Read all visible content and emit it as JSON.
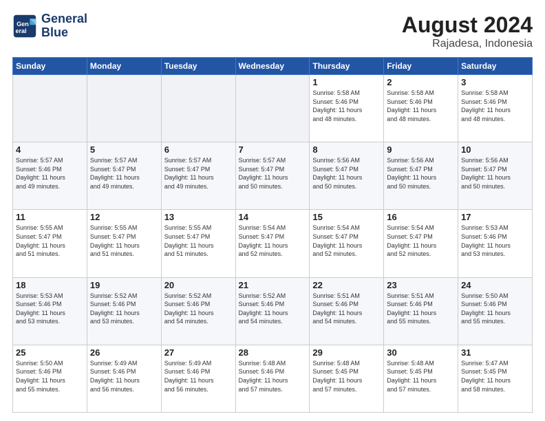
{
  "logo": {
    "line1": "General",
    "line2": "Blue"
  },
  "title": "August 2024",
  "subtitle": "Rajadesa, Indonesia",
  "weekdays": [
    "Sunday",
    "Monday",
    "Tuesday",
    "Wednesday",
    "Thursday",
    "Friday",
    "Saturday"
  ],
  "weeks": [
    [
      {
        "day": "",
        "info": ""
      },
      {
        "day": "",
        "info": ""
      },
      {
        "day": "",
        "info": ""
      },
      {
        "day": "",
        "info": ""
      },
      {
        "day": "1",
        "info": "Sunrise: 5:58 AM\nSunset: 5:46 PM\nDaylight: 11 hours\nand 48 minutes."
      },
      {
        "day": "2",
        "info": "Sunrise: 5:58 AM\nSunset: 5:46 PM\nDaylight: 11 hours\nand 48 minutes."
      },
      {
        "day": "3",
        "info": "Sunrise: 5:58 AM\nSunset: 5:46 PM\nDaylight: 11 hours\nand 48 minutes."
      }
    ],
    [
      {
        "day": "4",
        "info": "Sunrise: 5:57 AM\nSunset: 5:46 PM\nDaylight: 11 hours\nand 49 minutes."
      },
      {
        "day": "5",
        "info": "Sunrise: 5:57 AM\nSunset: 5:47 PM\nDaylight: 11 hours\nand 49 minutes."
      },
      {
        "day": "6",
        "info": "Sunrise: 5:57 AM\nSunset: 5:47 PM\nDaylight: 11 hours\nand 49 minutes."
      },
      {
        "day": "7",
        "info": "Sunrise: 5:57 AM\nSunset: 5:47 PM\nDaylight: 11 hours\nand 50 minutes."
      },
      {
        "day": "8",
        "info": "Sunrise: 5:56 AM\nSunset: 5:47 PM\nDaylight: 11 hours\nand 50 minutes."
      },
      {
        "day": "9",
        "info": "Sunrise: 5:56 AM\nSunset: 5:47 PM\nDaylight: 11 hours\nand 50 minutes."
      },
      {
        "day": "10",
        "info": "Sunrise: 5:56 AM\nSunset: 5:47 PM\nDaylight: 11 hours\nand 50 minutes."
      }
    ],
    [
      {
        "day": "11",
        "info": "Sunrise: 5:55 AM\nSunset: 5:47 PM\nDaylight: 11 hours\nand 51 minutes."
      },
      {
        "day": "12",
        "info": "Sunrise: 5:55 AM\nSunset: 5:47 PM\nDaylight: 11 hours\nand 51 minutes."
      },
      {
        "day": "13",
        "info": "Sunrise: 5:55 AM\nSunset: 5:47 PM\nDaylight: 11 hours\nand 51 minutes."
      },
      {
        "day": "14",
        "info": "Sunrise: 5:54 AM\nSunset: 5:47 PM\nDaylight: 11 hours\nand 52 minutes."
      },
      {
        "day": "15",
        "info": "Sunrise: 5:54 AM\nSunset: 5:47 PM\nDaylight: 11 hours\nand 52 minutes."
      },
      {
        "day": "16",
        "info": "Sunrise: 5:54 AM\nSunset: 5:47 PM\nDaylight: 11 hours\nand 52 minutes."
      },
      {
        "day": "17",
        "info": "Sunrise: 5:53 AM\nSunset: 5:46 PM\nDaylight: 11 hours\nand 53 minutes."
      }
    ],
    [
      {
        "day": "18",
        "info": "Sunrise: 5:53 AM\nSunset: 5:46 PM\nDaylight: 11 hours\nand 53 minutes."
      },
      {
        "day": "19",
        "info": "Sunrise: 5:52 AM\nSunset: 5:46 PM\nDaylight: 11 hours\nand 53 minutes."
      },
      {
        "day": "20",
        "info": "Sunrise: 5:52 AM\nSunset: 5:46 PM\nDaylight: 11 hours\nand 54 minutes."
      },
      {
        "day": "21",
        "info": "Sunrise: 5:52 AM\nSunset: 5:46 PM\nDaylight: 11 hours\nand 54 minutes."
      },
      {
        "day": "22",
        "info": "Sunrise: 5:51 AM\nSunset: 5:46 PM\nDaylight: 11 hours\nand 54 minutes."
      },
      {
        "day": "23",
        "info": "Sunrise: 5:51 AM\nSunset: 5:46 PM\nDaylight: 11 hours\nand 55 minutes."
      },
      {
        "day": "24",
        "info": "Sunrise: 5:50 AM\nSunset: 5:46 PM\nDaylight: 11 hours\nand 55 minutes."
      }
    ],
    [
      {
        "day": "25",
        "info": "Sunrise: 5:50 AM\nSunset: 5:46 PM\nDaylight: 11 hours\nand 55 minutes."
      },
      {
        "day": "26",
        "info": "Sunrise: 5:49 AM\nSunset: 5:46 PM\nDaylight: 11 hours\nand 56 minutes."
      },
      {
        "day": "27",
        "info": "Sunrise: 5:49 AM\nSunset: 5:46 PM\nDaylight: 11 hours\nand 56 minutes."
      },
      {
        "day": "28",
        "info": "Sunrise: 5:48 AM\nSunset: 5:46 PM\nDaylight: 11 hours\nand 57 minutes."
      },
      {
        "day": "29",
        "info": "Sunrise: 5:48 AM\nSunset: 5:45 PM\nDaylight: 11 hours\nand 57 minutes."
      },
      {
        "day": "30",
        "info": "Sunrise: 5:48 AM\nSunset: 5:45 PM\nDaylight: 11 hours\nand 57 minutes."
      },
      {
        "day": "31",
        "info": "Sunrise: 5:47 AM\nSunset: 5:45 PM\nDaylight: 11 hours\nand 58 minutes."
      }
    ]
  ]
}
